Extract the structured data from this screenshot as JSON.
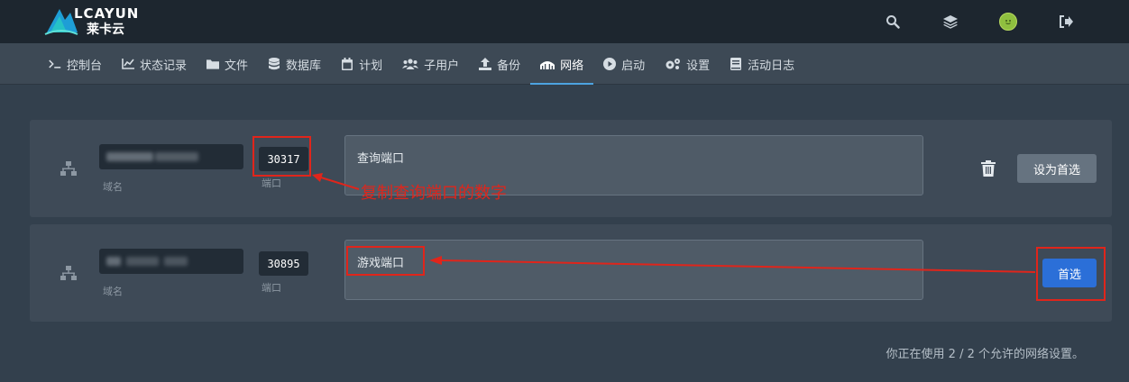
{
  "brand": {
    "logo_top": "LCAYUN",
    "logo_bottom": "莱卡云"
  },
  "topbar": {
    "icons": [
      "search-icon",
      "layers-icon",
      "avatar",
      "logout-icon"
    ]
  },
  "nav": {
    "items": [
      {
        "label": "控制台",
        "icon": "terminal-icon"
      },
      {
        "label": "状态记录",
        "icon": "chart-icon"
      },
      {
        "label": "文件",
        "icon": "folder-icon"
      },
      {
        "label": "数据库",
        "icon": "database-icon"
      },
      {
        "label": "计划",
        "icon": "calendar-icon"
      },
      {
        "label": "子用户",
        "icon": "users-icon"
      },
      {
        "label": "备份",
        "icon": "upload-icon"
      },
      {
        "label": "网络",
        "icon": "network-icon",
        "active": true
      },
      {
        "label": "启动",
        "icon": "play-icon"
      },
      {
        "label": "设置",
        "icon": "gears-icon"
      },
      {
        "label": "活动日志",
        "icon": "book-icon"
      }
    ]
  },
  "allocations": [
    {
      "domain_label": "域名",
      "port": "30317",
      "port_label": "端口",
      "notes": "查询端口",
      "action_label": "设为首选",
      "primary": false
    },
    {
      "domain_label": "域名",
      "port": "30895",
      "port_label": "端口",
      "notes": "游戏端口",
      "action_label": "首选",
      "primary": true
    }
  ],
  "footer": {
    "usage_text": "你正在使用 2 / 2 个允许的网络设置。"
  },
  "annotation": {
    "text": "复制查询端口的数字"
  },
  "colors": {
    "accent": "#4da3e0",
    "primary_button": "#2b6fd8",
    "annotation": "#e0251b"
  }
}
